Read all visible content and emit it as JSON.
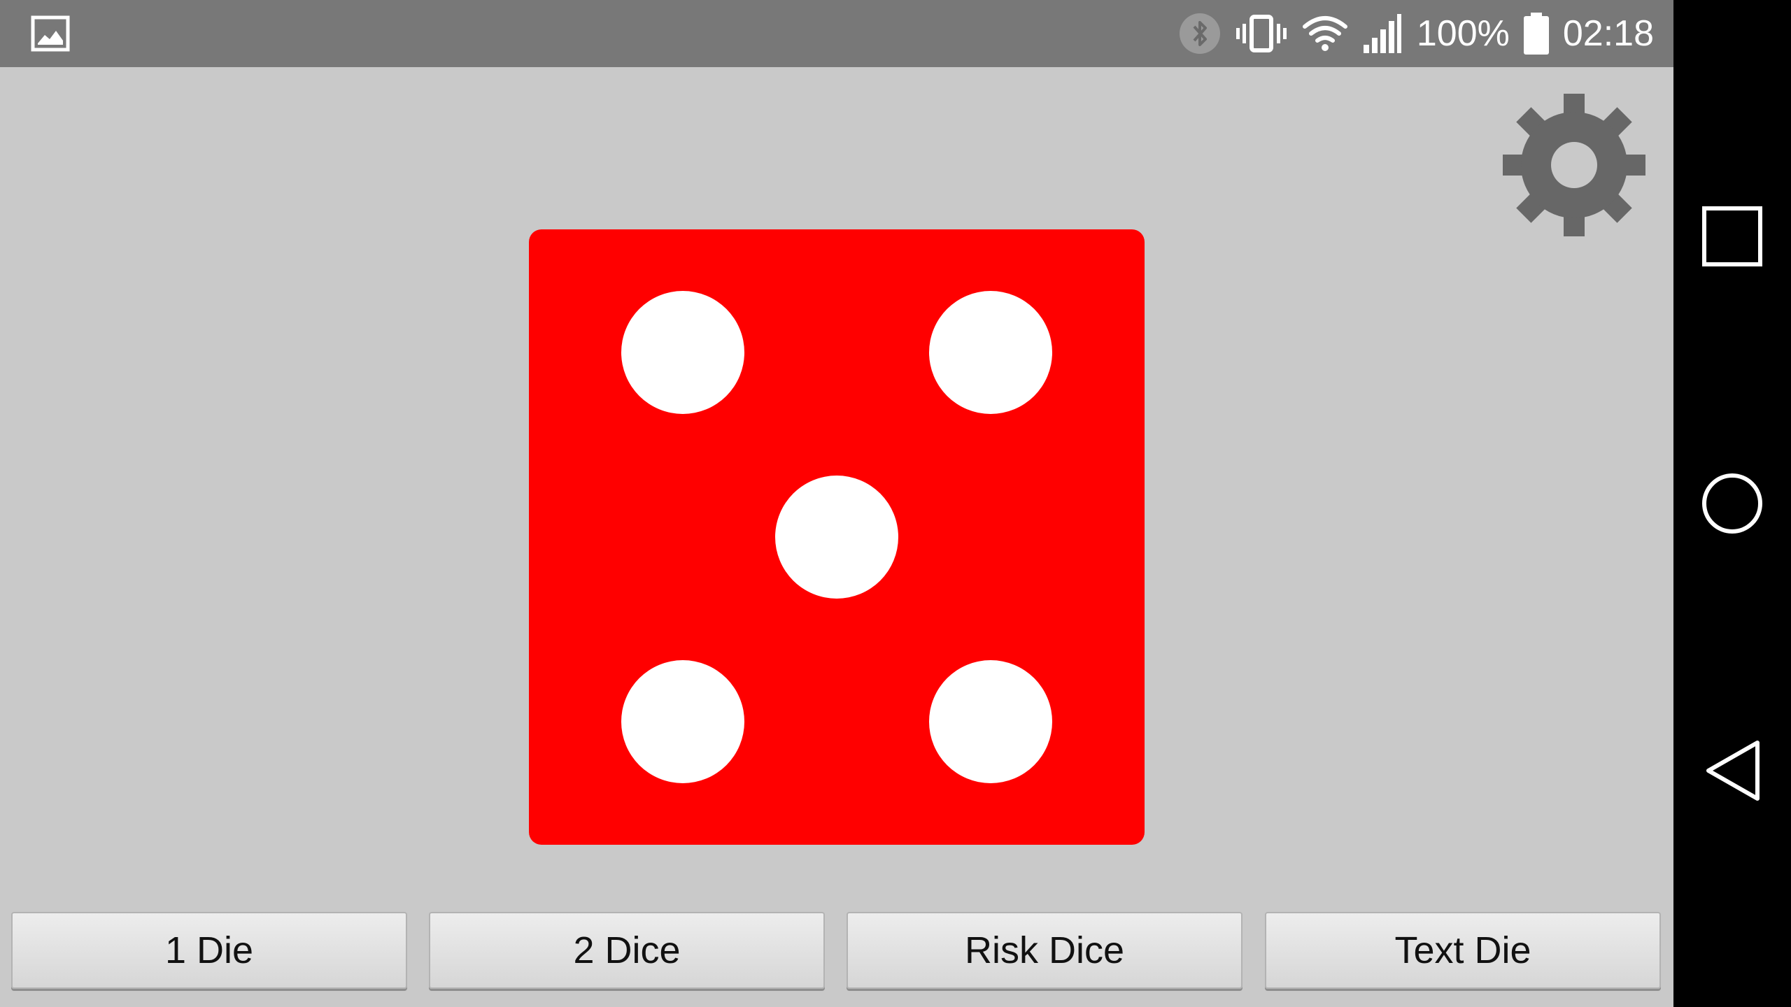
{
  "status_bar": {
    "notification_icon": "image-icon",
    "icons": [
      "bluetooth-icon",
      "vibrate-icon",
      "wifi-icon",
      "cell-signal-icon"
    ],
    "battery_percent": "100%",
    "battery_icon": "battery-full-icon",
    "clock": "02:18"
  },
  "app": {
    "settings_icon": "gear-icon",
    "die": {
      "face_value": 5,
      "color": "#ff0000",
      "pip_color": "#ffffff"
    },
    "buttons": [
      {
        "label": "1 Die"
      },
      {
        "label": "2 Dice"
      },
      {
        "label": "Risk Dice"
      },
      {
        "label": "Text Die"
      }
    ]
  },
  "nav_bar": {
    "recents_icon": "recents-square-icon",
    "home_icon": "home-circle-icon",
    "back_icon": "back-triangle-icon"
  },
  "colors": {
    "status_bar_bg": "#787878",
    "app_bg": "#c9c9c9",
    "nav_bar_bg": "#000000",
    "gear": "#676767"
  }
}
